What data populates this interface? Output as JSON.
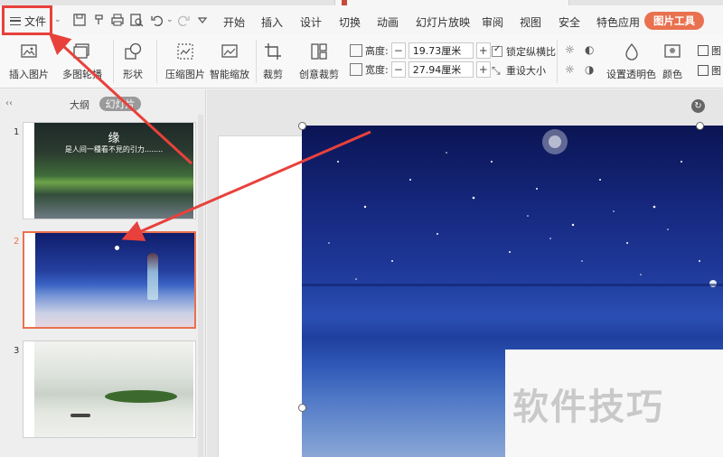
{
  "menubar": {
    "file_label": "文件",
    "items": [
      "开始",
      "插入",
      "设计",
      "切换",
      "动画",
      "幻灯片放映",
      "审阅",
      "视图",
      "安全",
      "特色应用"
    ],
    "tool_tab": "图片工具"
  },
  "ribbon": {
    "insert_picture": "插入图片",
    "multi_picture": "多图轮播",
    "shape": "形状",
    "compress": "压缩图片",
    "smart_zoom": "智能缩放",
    "crop": "裁剪",
    "creative_crop": "创意裁剪",
    "height_label": "高度:",
    "height_value": "19.73厘米",
    "width_label": "宽度:",
    "width_value": "27.94厘米",
    "lock_ratio": "锁定纵横比",
    "reset_size": "重设大小",
    "transparent": "设置透明色",
    "color": "颜色",
    "more": "图"
  },
  "pane": {
    "collapse": "‹‹",
    "tab_outline": "大纲",
    "tab_slides": "幻灯片",
    "slides": [
      {
        "num": "1",
        "title": "缘",
        "subtitle": "是人间一種看不見的引力........"
      },
      {
        "num": "2"
      },
      {
        "num": "3"
      }
    ]
  },
  "canvas": {
    "watermark": "软件技巧"
  },
  "colors": {
    "accent": "#e9714f",
    "annotation": "#e8413c"
  }
}
